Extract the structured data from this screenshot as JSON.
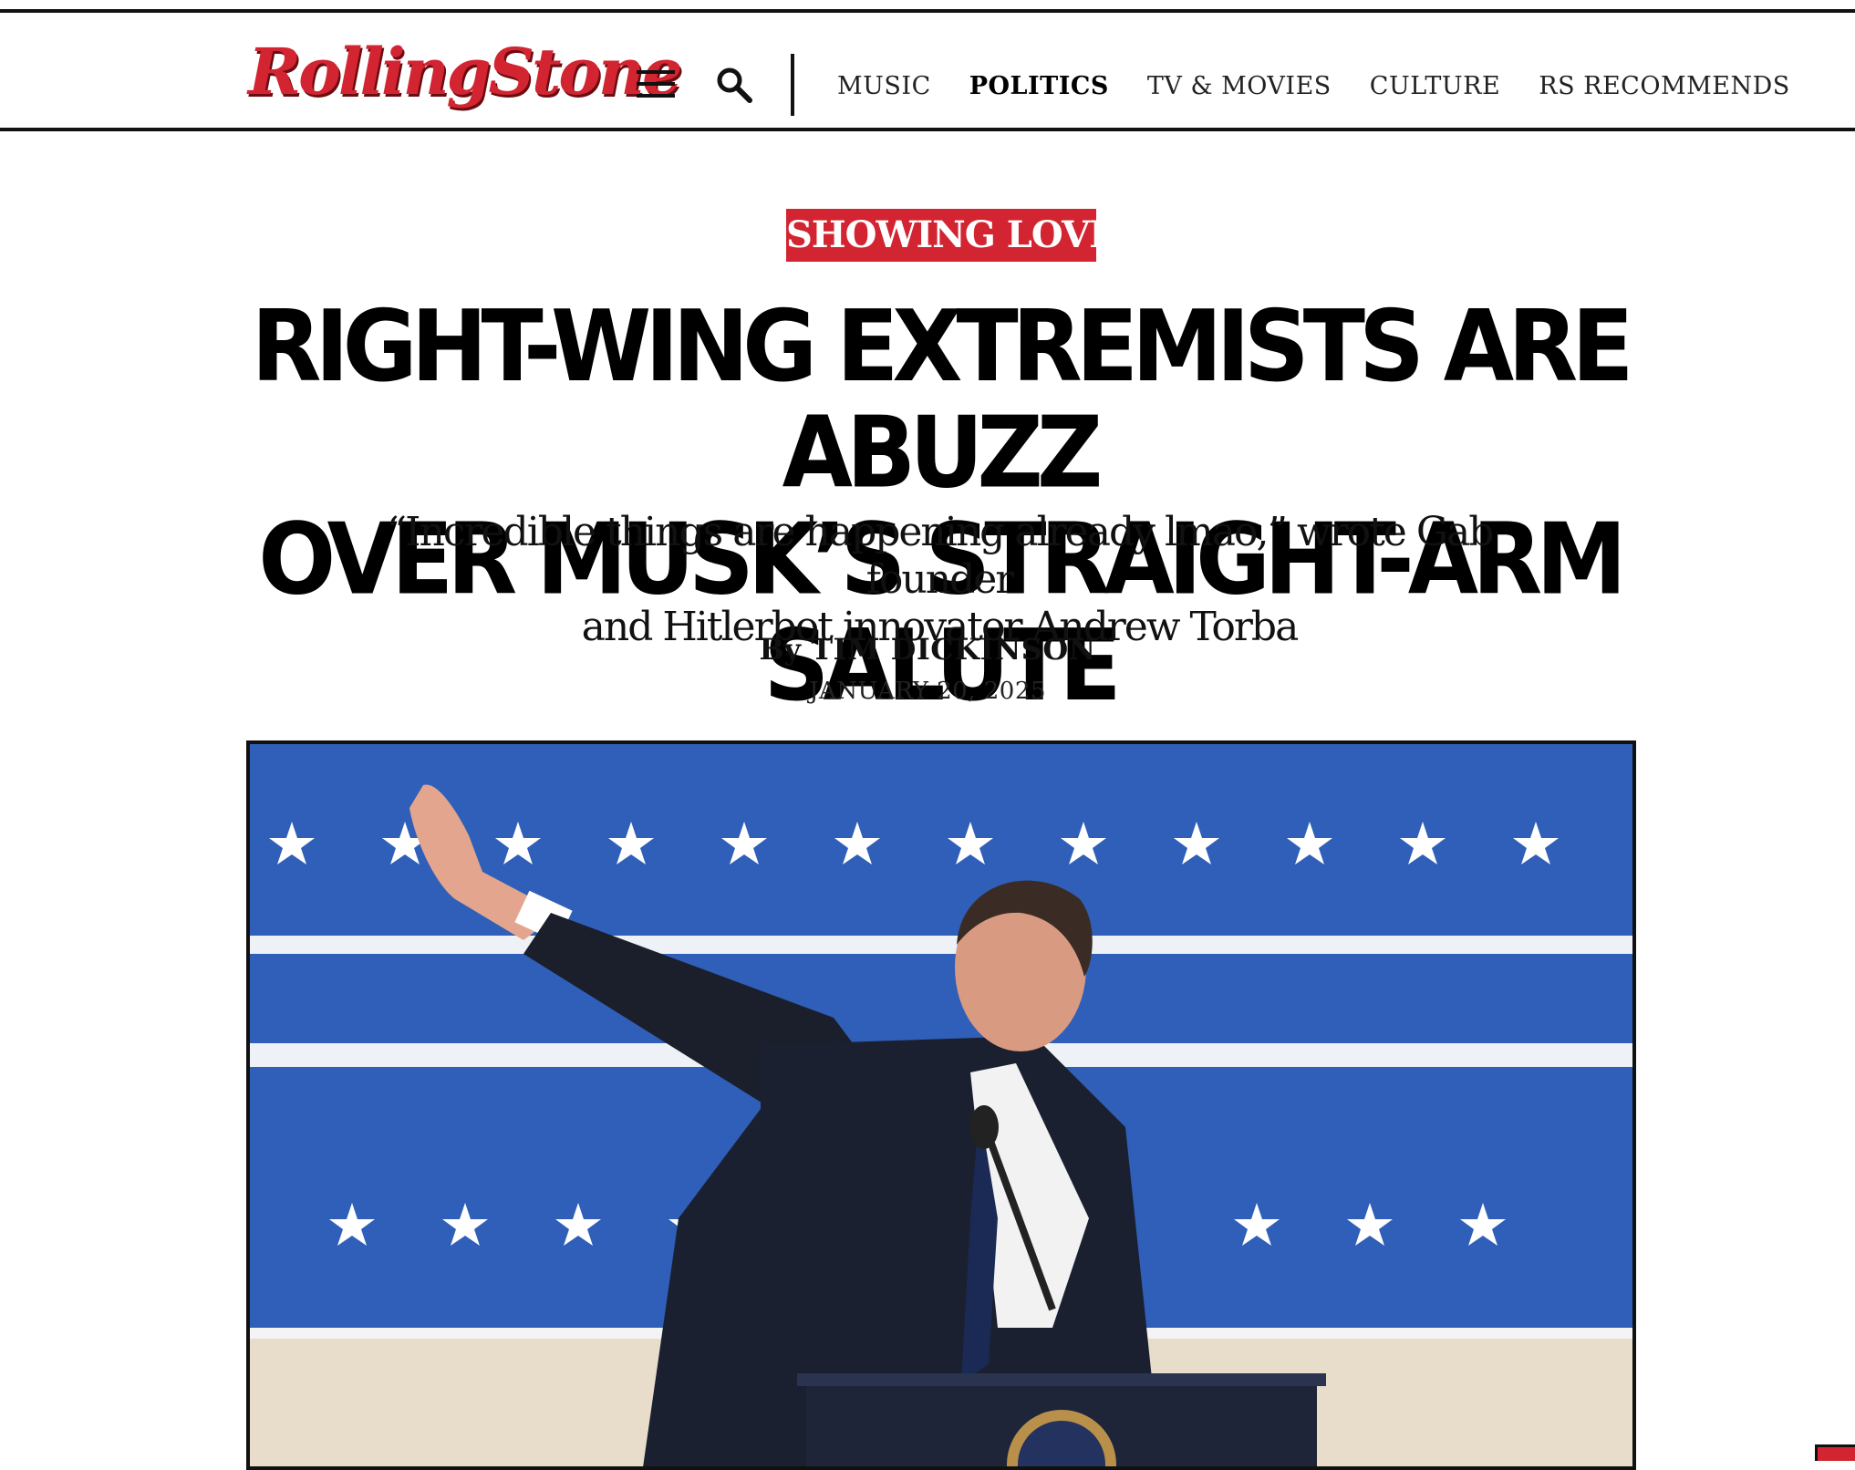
{
  "header": {
    "logo_text": "RollingStone",
    "menu_icon": "hamburger-menu-icon",
    "search_icon": "search-icon",
    "nav": [
      {
        "label": "MUSIC",
        "active": false
      },
      {
        "label": "POLITICS",
        "active": true
      },
      {
        "label": "TV & MOVIES",
        "active": false
      },
      {
        "label": "CULTURE",
        "active": false
      },
      {
        "label": "RS RECOMMENDS",
        "active": false
      }
    ]
  },
  "article": {
    "kicker": "SHOWING LOVE",
    "headline_line1": "RIGHT-WING EXTREMISTS ARE ABUZZ",
    "headline_line2": "OVER MUSK’S STRAIGHT-ARM SALUTE",
    "dek_line1": "“Incredible things are happening already lmao,” wrote Gab founder",
    "dek_line2": "and Hitlerbot innovator Andrew Torba",
    "byline_prefix": "By",
    "author": "TIM DICKINSON",
    "date": "JANUARY 20, 2025"
  },
  "colors": {
    "brand_red": "#d32531",
    "photo_blue": "#2f5fb8"
  }
}
